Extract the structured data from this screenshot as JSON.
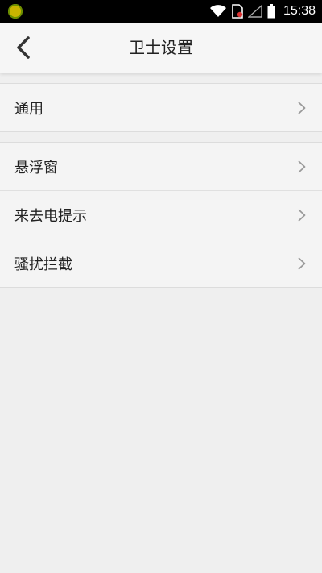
{
  "status_bar": {
    "time": "15:38",
    "icons": [
      "app-notification-icon",
      "wifi-icon",
      "sim-icon",
      "signal-icon",
      "battery-icon"
    ]
  },
  "header": {
    "title": "卫士设置",
    "back_icon": "back-chevron-icon"
  },
  "groups": [
    {
      "items": [
        {
          "label": "通用"
        }
      ]
    },
    {
      "items": [
        {
          "label": "悬浮窗"
        },
        {
          "label": "来去电提示"
        },
        {
          "label": "骚扰拦截"
        }
      ]
    }
  ],
  "colors": {
    "background": "#efefef",
    "header": "#f6f6f6",
    "row": "#f4f4f4",
    "divider": "#dcdcdc",
    "text": "#222222",
    "chevron": "#9a9a9a"
  }
}
